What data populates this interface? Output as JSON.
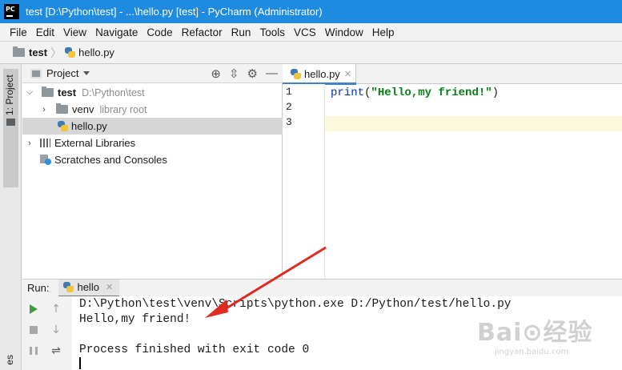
{
  "window": {
    "title": "test [D:\\Python\\test] - ...\\hello.py [test] - PyCharm (Administrator)",
    "logo_text": "PC"
  },
  "menu": [
    "File",
    "Edit",
    "View",
    "Navigate",
    "Code",
    "Refactor",
    "Run",
    "Tools",
    "VCS",
    "Window",
    "Help"
  ],
  "breadcrumb": {
    "project": "test",
    "file": "hello.py"
  },
  "left_strip": {
    "project_tab": "1: Project",
    "bottom_tab": "es"
  },
  "project_panel": {
    "title": "Project",
    "tree": [
      {
        "label": "test",
        "detail": "D:\\Python\\test",
        "expanded": true
      },
      {
        "label": "venv",
        "detail": "library root",
        "expanded": false
      },
      {
        "label": "hello.py",
        "selected": true
      },
      {
        "label": "External Libraries",
        "expanded": false
      },
      {
        "label": "Scratches and Consoles"
      }
    ]
  },
  "editor": {
    "tab_label": "hello.py",
    "line_numbers": [
      "1",
      "2",
      "3"
    ],
    "code": {
      "func": "print",
      "open": "(",
      "string": "\"Hello,my friend!\"",
      "close": ")"
    }
  },
  "run_panel": {
    "label": "Run:",
    "tab_label": "hello",
    "console_lines": [
      "D:\\Python\\test\\venv\\Scripts\\python.exe D:/Python/test/hello.py",
      "Hello,my friend!",
      "",
      "Process finished with exit code 0"
    ]
  },
  "watermark": {
    "brand": "Bai⊙经验",
    "url": "jingyan.baidu.com"
  },
  "colors": {
    "titlebar": "#1e8ae0",
    "annotation_arrow": "#e02b20",
    "selection": "#d6d6d6",
    "current_line": "#fcf8dc"
  },
  "icons": {
    "project_tool_buttons": [
      "locate-icon",
      "collapse-icon",
      "gear-icon",
      "minimize-icon"
    ],
    "run_tool_buttons": [
      "run-icon",
      "stop-icon",
      "pause-icon",
      "scroll-up-icon",
      "scroll-down-icon",
      "soft-wrap-icon"
    ]
  }
}
